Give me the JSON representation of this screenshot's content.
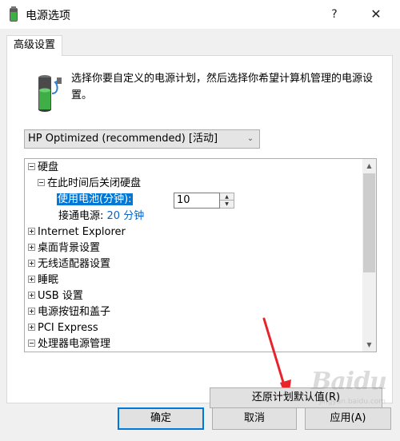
{
  "window": {
    "title": "电源选项",
    "help_glyph": "?",
    "close_glyph": "✕"
  },
  "tabs": [
    {
      "label": "高级设置"
    }
  ],
  "description": "选择你要自定义的电源计划，然后选择你希望计算机管理的电源设置。",
  "plan_dropdown": {
    "selected": "HP Optimized (recommended) [活动]"
  },
  "tree": {
    "hard_disk": {
      "label": "硬盘",
      "child": {
        "label": "在此时间后关闭硬盘",
        "on_battery_label": "使用电池(分钟):",
        "on_battery_value": "10",
        "plugged_in_label": "接通电源:",
        "plugged_in_value": "20 分钟"
      }
    },
    "items": [
      {
        "label": "Internet Explorer"
      },
      {
        "label": "桌面背景设置"
      },
      {
        "label": "无线适配器设置"
      },
      {
        "label": "睡眠"
      },
      {
        "label": "USB 设置"
      },
      {
        "label": "电源按钮和盖子"
      },
      {
        "label": "PCI Express"
      },
      {
        "label": "处理器电源管理"
      }
    ]
  },
  "buttons": {
    "restore_defaults": "还原计划默认值(R)",
    "ok": "确定",
    "cancel": "取消",
    "apply": "应用(A)"
  },
  "watermark": {
    "brand": "Baidu",
    "sub": "jingyan.baidu.com"
  },
  "colors": {
    "accent": "#0078d7",
    "annotation_arrow": "#e8232a",
    "link": "#0066cc"
  }
}
